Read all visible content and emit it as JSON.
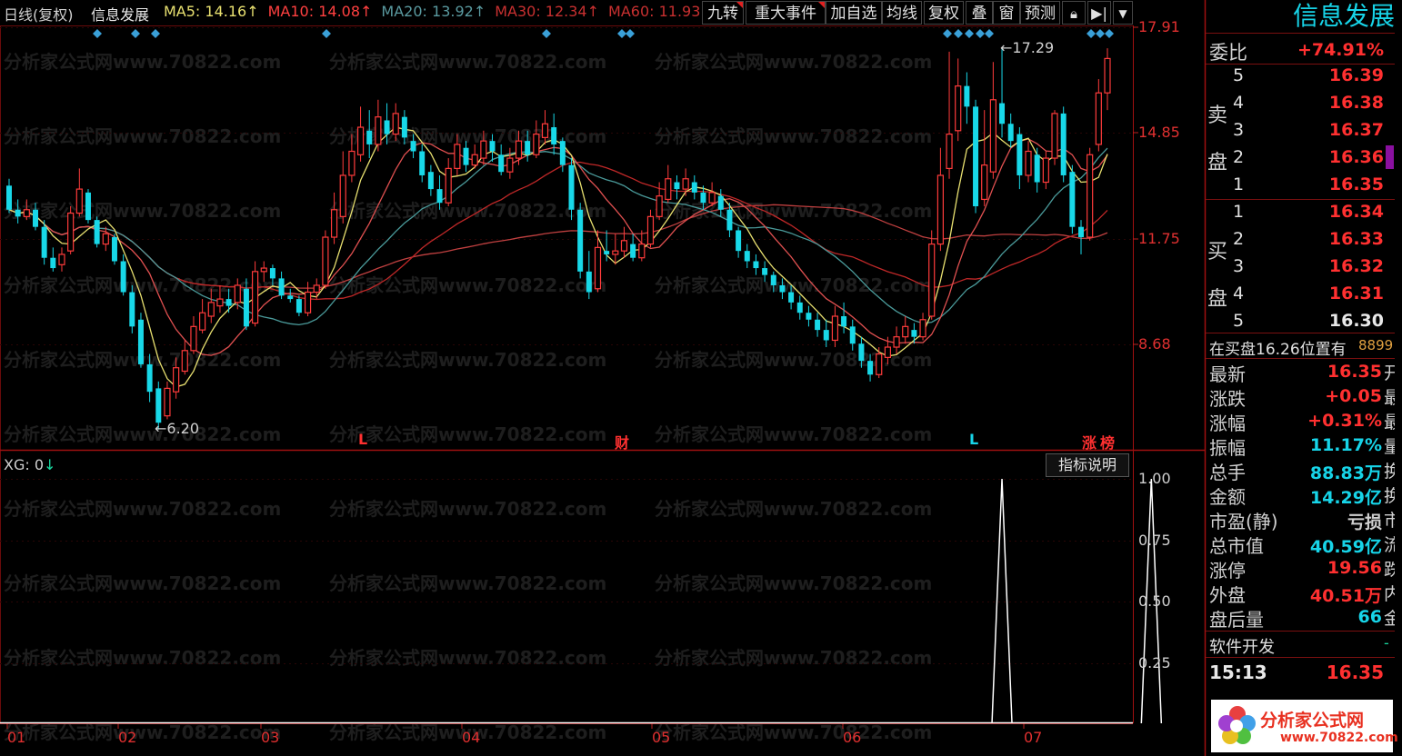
{
  "colors": {
    "up": "#ff3b3b",
    "down": "#18d8e8",
    "ma5": "#e8e070",
    "ma10": "#e05050",
    "ma20": "#4a9a9a",
    "ma30": "#c02828",
    "ma60": "#c04040",
    "grid": "#6a0a0a",
    "accent": "#ff3030",
    "value": "#17d4e8"
  },
  "chart": {
    "period_label": "日线(复权)",
    "stock_name": "信息发展",
    "ma_legend": [
      {
        "label": "MA5:",
        "value": "14.16",
        "arrow": "↑",
        "color": "#e8e070"
      },
      {
        "label": "MA10:",
        "value": "14.08",
        "arrow": "↑",
        "color": "#ff4040"
      },
      {
        "label": "MA20:",
        "value": "13.92",
        "arrow": "↑",
        "color": "#5a9aa0"
      },
      {
        "label": "MA30:",
        "value": "12.34",
        "arrow": "↑",
        "color": "#c83030"
      },
      {
        "label": "MA60:",
        "value": "11.93",
        "arrow": "",
        "color": "#c83030"
      }
    ],
    "y_ticks": [
      "17.91",
      "14.85",
      "11.75",
      "8.68"
    ],
    "high_marker": "17.29",
    "low_marker": "6.20",
    "signal_marks": [
      {
        "text": "L",
        "color": "#ff3030"
      },
      {
        "text": "财",
        "color": "#ff3030"
      },
      {
        "text": "L",
        "color": "#17d4e8"
      },
      {
        "text": "涨",
        "color": "#ff3030"
      },
      {
        "text": "榜",
        "color": "#ff3030"
      }
    ],
    "candles": [
      [
        13.3,
        12.6,
        13.5,
        12.5
      ],
      [
        12.6,
        12.4,
        12.9,
        12.2
      ],
      [
        12.4,
        12.6,
        12.9,
        12.3
      ],
      [
        12.6,
        12.1,
        12.8,
        12.0
      ],
      [
        12.1,
        11.2,
        12.3,
        11.0
      ],
      [
        11.2,
        10.9,
        11.5,
        10.8
      ],
      [
        11.0,
        11.3,
        11.5,
        10.8
      ],
      [
        11.4,
        12.5,
        12.7,
        11.3
      ],
      [
        12.5,
        13.2,
        13.8,
        12.4
      ],
      [
        13.1,
        12.3,
        13.2,
        12.2
      ],
      [
        12.3,
        11.6,
        12.4,
        11.5
      ],
      [
        11.6,
        11.9,
        12.1,
        11.4
      ],
      [
        11.8,
        11.1,
        11.9,
        11.0
      ],
      [
        11.1,
        10.2,
        11.3,
        10.1
      ],
      [
        10.2,
        9.2,
        10.4,
        9.0
      ],
      [
        9.4,
        8.1,
        9.6,
        8.0
      ],
      [
        8.1,
        7.3,
        8.4,
        7.0
      ],
      [
        7.4,
        6.4,
        7.6,
        6.2
      ],
      [
        6.6,
        7.4,
        7.6,
        6.5
      ],
      [
        7.3,
        8.0,
        8.3,
        7.1
      ],
      [
        7.9,
        8.5,
        8.8,
        7.8
      ],
      [
        8.5,
        9.2,
        9.5,
        8.4
      ],
      [
        9.1,
        9.6,
        10.0,
        9.0
      ],
      [
        9.5,
        9.9,
        10.3,
        9.3
      ],
      [
        9.8,
        10.0,
        10.4,
        9.6
      ],
      [
        10.0,
        9.8,
        10.3,
        9.6
      ],
      [
        9.9,
        10.4,
        10.6,
        9.7
      ],
      [
        10.3,
        9.2,
        10.6,
        9.1
      ],
      [
        9.3,
        10.8,
        11.1,
        9.2
      ],
      [
        10.8,
        10.9,
        11.1,
        10.5
      ],
      [
        10.9,
        10.6,
        11.0,
        10.4
      ],
      [
        10.6,
        10.1,
        10.8,
        10.0
      ],
      [
        10.1,
        10.0,
        10.3,
        9.9
      ],
      [
        10.0,
        9.6,
        10.1,
        9.5
      ],
      [
        9.6,
        10.2,
        10.5,
        9.5
      ],
      [
        10.2,
        10.4,
        10.6,
        10.0
      ],
      [
        10.4,
        11.8,
        12.0,
        10.3
      ],
      [
        11.8,
        12.6,
        13.1,
        11.6
      ],
      [
        12.4,
        13.6,
        14.3,
        12.2
      ],
      [
        13.6,
        14.3,
        14.8,
        13.4
      ],
      [
        14.2,
        15.0,
        15.6,
        14.0
      ],
      [
        14.9,
        14.5,
        15.5,
        14.1
      ],
      [
        14.5,
        15.3,
        15.8,
        14.3
      ],
      [
        15.2,
        14.8,
        15.7,
        14.5
      ],
      [
        14.8,
        15.4,
        15.7,
        14.6
      ],
      [
        15.3,
        14.7,
        15.5,
        14.5
      ],
      [
        14.6,
        14.3,
        14.8,
        14.1
      ],
      [
        14.3,
        13.6,
        14.5,
        13.4
      ],
      [
        13.7,
        13.2,
        13.9,
        13.0
      ],
      [
        13.2,
        12.8,
        13.6,
        12.6
      ],
      [
        12.8,
        13.8,
        14.1,
        12.7
      ],
      [
        13.8,
        14.5,
        14.8,
        13.6
      ],
      [
        14.4,
        13.9,
        14.6,
        13.7
      ],
      [
        13.9,
        14.2,
        14.5,
        13.8
      ],
      [
        14.1,
        14.6,
        14.9,
        13.9
      ],
      [
        14.6,
        14.3,
        14.8,
        14.0
      ],
      [
        14.2,
        13.7,
        14.5,
        13.6
      ],
      [
        13.7,
        14.1,
        14.4,
        13.5
      ],
      [
        14.1,
        14.6,
        14.9,
        13.9
      ],
      [
        14.6,
        14.2,
        14.9,
        14.0
      ],
      [
        14.2,
        14.8,
        15.2,
        14.1
      ],
      [
        14.7,
        15.1,
        15.5,
        14.5
      ],
      [
        15.0,
        14.5,
        15.4,
        14.2
      ],
      [
        14.6,
        13.9,
        14.7,
        13.7
      ],
      [
        13.9,
        12.6,
        14.1,
        12.3
      ],
      [
        12.6,
        10.8,
        12.8,
        10.6
      ],
      [
        10.8,
        10.2,
        11.4,
        10.0
      ],
      [
        10.3,
        11.5,
        12.0,
        10.2
      ],
      [
        11.4,
        11.3,
        12.0,
        11.1
      ],
      [
        11.3,
        11.4,
        11.9,
        11.0
      ],
      [
        11.4,
        11.7,
        12.1,
        11.2
      ],
      [
        11.6,
        11.2,
        11.9,
        11.1
      ],
      [
        11.2,
        11.6,
        12.0,
        11.1
      ],
      [
        11.6,
        12.4,
        12.6,
        11.5
      ],
      [
        12.4,
        13.0,
        13.4,
        12.3
      ],
      [
        12.9,
        13.5,
        13.9,
        12.8
      ],
      [
        13.4,
        13.2,
        13.6,
        12.9
      ],
      [
        13.2,
        13.5,
        13.8,
        13.0
      ],
      [
        13.4,
        13.1,
        13.6,
        12.9
      ],
      [
        13.1,
        12.8,
        13.3,
        12.6
      ],
      [
        12.8,
        13.1,
        13.4,
        12.7
      ],
      [
        13.0,
        12.6,
        13.2,
        12.4
      ],
      [
        12.6,
        12.0,
        12.8,
        11.8
      ],
      [
        12.0,
        11.4,
        12.1,
        11.2
      ],
      [
        11.4,
        11.1,
        11.6,
        10.9
      ],
      [
        11.1,
        10.9,
        11.3,
        10.7
      ],
      [
        10.9,
        10.7,
        11.1,
        10.5
      ],
      [
        10.7,
        10.4,
        10.8,
        10.2
      ],
      [
        10.4,
        10.2,
        10.6,
        10.0
      ],
      [
        10.2,
        9.9,
        10.4,
        9.7
      ],
      [
        9.9,
        9.6,
        10.1,
        9.4
      ],
      [
        9.6,
        9.4,
        9.8,
        9.2
      ],
      [
        9.4,
        9.1,
        9.6,
        8.9
      ],
      [
        9.1,
        8.8,
        9.4,
        8.6
      ],
      [
        8.8,
        9.5,
        9.8,
        8.6
      ],
      [
        9.5,
        9.2,
        9.9,
        9.0
      ],
      [
        9.2,
        8.7,
        9.4,
        8.5
      ],
      [
        8.7,
        8.2,
        8.9,
        8.0
      ],
      [
        8.2,
        7.8,
        8.4,
        7.6
      ],
      [
        7.8,
        8.4,
        8.6,
        7.7
      ],
      [
        8.3,
        8.6,
        8.9,
        8.1
      ],
      [
        8.6,
        8.9,
        9.2,
        8.4
      ],
      [
        8.9,
        9.2,
        9.5,
        8.7
      ],
      [
        9.1,
        8.9,
        9.3,
        8.7
      ],
      [
        8.9,
        9.4,
        9.6,
        8.8
      ],
      [
        9.5,
        11.6,
        12.0,
        9.4
      ],
      [
        11.6,
        13.6,
        14.4,
        11.4
      ],
      [
        13.8,
        14.8,
        17.2,
        13.5
      ],
      [
        14.9,
        16.2,
        17.0,
        14.6
      ],
      [
        16.2,
        15.6,
        16.6,
        15.1
      ],
      [
        15.6,
        12.7,
        15.8,
        12.5
      ],
      [
        12.9,
        13.9,
        15.5,
        12.7
      ],
      [
        13.7,
        15.8,
        16.9,
        13.5
      ],
      [
        15.7,
        15.1,
        17.3,
        14.7
      ],
      [
        15.1,
        14.6,
        15.4,
        14.4
      ],
      [
        14.8,
        13.6,
        15.0,
        13.2
      ],
      [
        13.6,
        14.3,
        14.6,
        13.4
      ],
      [
        14.2,
        13.4,
        14.4,
        13.1
      ],
      [
        13.4,
        14.1,
        14.3,
        13.2
      ],
      [
        14.1,
        15.4,
        15.5,
        13.9
      ],
      [
        15.4,
        13.6,
        15.6,
        13.4
      ],
      [
        13.7,
        12.1,
        13.9,
        11.9
      ],
      [
        12.1,
        11.8,
        12.3,
        11.3
      ],
      [
        11.8,
        14.2,
        14.4,
        11.7
      ],
      [
        14.5,
        16.0,
        16.4,
        14.3
      ],
      [
        16.0,
        17.0,
        17.3,
        15.5
      ]
    ]
  },
  "indicator": {
    "label": "XG: 0",
    "arrow": "↓",
    "button": "指标说明",
    "y_ticks": [
      "1.00",
      "0.75",
      "0.50",
      "0.25"
    ],
    "signal_days": [
      113,
      130
    ]
  },
  "x_axis": [
    "01",
    "02",
    "03",
    "04",
    "05",
    "06",
    "07"
  ],
  "toolbar": {
    "buttons": [
      "九转",
      "重大事件",
      "加自选",
      "均线",
      "复权",
      "叠",
      "窗",
      "预测"
    ]
  },
  "panel": {
    "title": "信息发展",
    "weibi_label": "委比",
    "weibi_value": "+74.91%",
    "sell_label": "卖盘",
    "buy_label": "买盘",
    "sell": [
      {
        "lvl": "5",
        "price": "16.39"
      },
      {
        "lvl": "4",
        "price": "16.38"
      },
      {
        "lvl": "3",
        "price": "16.37"
      },
      {
        "lvl": "2",
        "price": "16.36"
      },
      {
        "lvl": "1",
        "price": "16.35"
      }
    ],
    "buy": [
      {
        "lvl": "1",
        "price": "16.34"
      },
      {
        "lvl": "2",
        "price": "16.33"
      },
      {
        "lvl": "3",
        "price": "16.32"
      },
      {
        "lvl": "4",
        "price": "16.31"
      },
      {
        "lvl": "5",
        "price": "16.30"
      }
    ],
    "notice": "在买盘16.26位置有",
    "notice_num": "8899",
    "stats": [
      {
        "label": "最新",
        "value": "16.35",
        "color": "#ff3030",
        "tail": "开"
      },
      {
        "label": "涨跌",
        "value": "+0.05",
        "color": "#ff3030",
        "tail": "最"
      },
      {
        "label": "涨幅",
        "value": "+0.31%",
        "color": "#ff3030",
        "tail": "最"
      },
      {
        "label": "振幅",
        "value": "11.17%",
        "color": "#17d4e8",
        "tail": "量"
      },
      {
        "label": "总手",
        "value": "88.83万",
        "color": "#17d4e8",
        "tail": "换"
      },
      {
        "label": "金额",
        "value": "14.29亿",
        "color": "#17d4e8",
        "tail": "换"
      },
      {
        "label": "市盈(静)",
        "value": "亏损",
        "color": "#d0d0d0",
        "tail": "市"
      },
      {
        "label": "总市值",
        "value": "40.59亿",
        "color": "#17d4e8",
        "tail": "流"
      },
      {
        "label": "涨停",
        "value": "19.56",
        "color": "#ff3030",
        "tail": "跌"
      },
      {
        "label": "外盘",
        "value": "40.51万",
        "color": "#ff3030",
        "tail": "内"
      },
      {
        "label": "盘后量",
        "value": "66",
        "color": "#17d4e8",
        "tail": "金"
      }
    ],
    "software_label": "软件开发",
    "software_value": "-",
    "time": "15:13",
    "time_price": "16.35",
    "logo_text": "分析家公式网",
    "logo_url": "www.70822.com"
  },
  "watermark": "分析家公式网www.70822.com"
}
